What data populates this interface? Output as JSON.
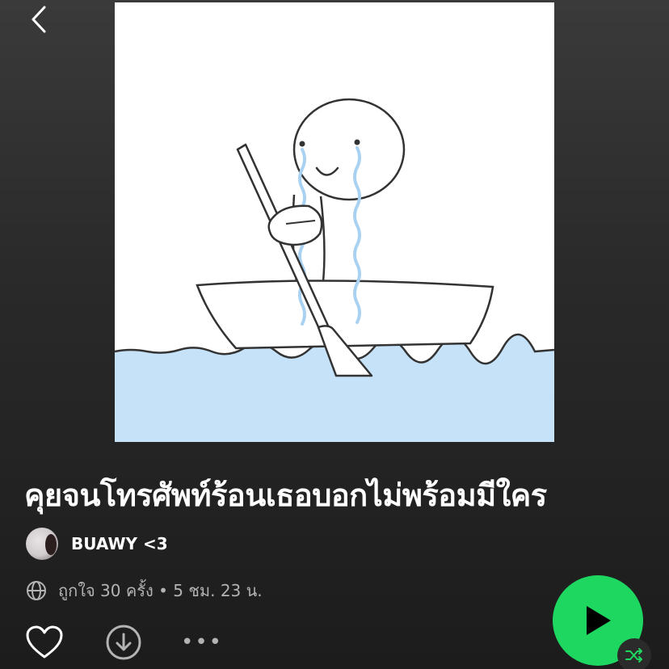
{
  "header": {
    "back_icon": "chevron-left-icon"
  },
  "playlist": {
    "title": "คุยจนโทรศัพท์ร้อนเธอบอกไม่พร้อมมีใคร",
    "owner": "BUAWY <3",
    "meta": "ถูกใจ 30 ครั้ง • 5 ชม. 23 น.",
    "visibility_icon": "globe-icon"
  },
  "actions": {
    "like_icon": "heart-icon",
    "download_icon": "download-icon",
    "more_label": "•••",
    "play_icon": "play-icon",
    "shuffle_icon": "shuffle-icon"
  },
  "colors": {
    "accent": "#1ed760",
    "background": "#2a2a2a",
    "secondary_text": "#b3b3b3",
    "water": "#c6e2f9",
    "tears": "#a9d2f2"
  }
}
